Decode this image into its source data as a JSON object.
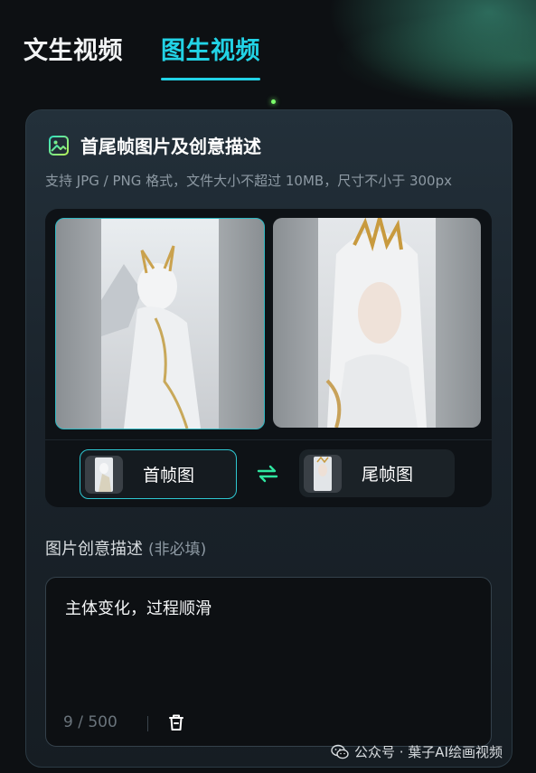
{
  "tabs": [
    {
      "label": "文生视频",
      "active": false
    },
    {
      "label": "图生视频",
      "active": true
    }
  ],
  "section": {
    "icon": "image-icon",
    "title": "首尾帧图片及创意描述",
    "hint": "支持 JPG / PNG 格式，文件大小不超过 10MB，尺寸不小于 300px"
  },
  "frames": {
    "first_label": "首帧图",
    "last_label": "尾帧图",
    "swap_icon": "swap-arrows-icon",
    "selected": "first"
  },
  "description": {
    "label": "图片创意描述",
    "optional": "(非必填)",
    "value": "主体变化，过程顺滑",
    "counter": "9 / 500",
    "delete_icon": "trash-icon"
  },
  "watermark": {
    "icon": "wechat-icon",
    "text": "公众号 · 葉子AI绘画视频"
  },
  "colors": {
    "accent": "#22d3e6",
    "swap": "#2ee6a0",
    "background": "#0d1013"
  }
}
